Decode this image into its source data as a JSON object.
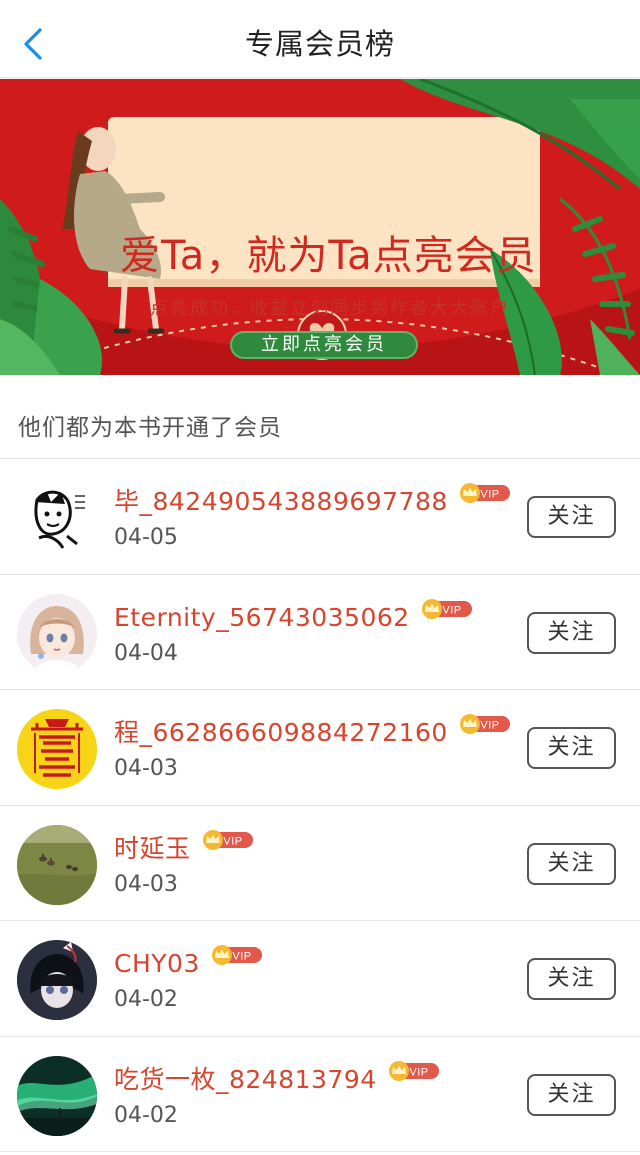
{
  "header": {
    "title": "专属会员榜",
    "back_icon": "chevron-left-icon"
  },
  "banner": {
    "headline": "爱Ta，就为Ta点亮会员",
    "subtitle": "点亮成功，收益立刻同步到作者大大账户",
    "button_label": "立即点亮会员",
    "colors": {
      "background": "#cf1b1c",
      "card": "#fbe3c3",
      "button": "#2f8a3e",
      "headline": "#d1281f"
    }
  },
  "section": {
    "title": "他们都为本书开通了会员"
  },
  "members": [
    {
      "name": "毕_842490543889697788",
      "badge": "VIP",
      "date": "04-05",
      "follow_label": "关注",
      "avatar": "sketch-avatar"
    },
    {
      "name": "Eternity_56743035062",
      "badge": "VIP",
      "date": "04-04",
      "follow_label": "关注",
      "avatar": "anime-girl-avatar"
    },
    {
      "name": "程_662866609884272160",
      "badge": "VIP",
      "date": "04-03",
      "follow_label": "关注",
      "avatar": "yellow-talisman-avatar"
    },
    {
      "name": "时延玉",
      "badge": "VIP",
      "date": "04-03",
      "follow_label": "关注",
      "avatar": "ducks-on-grass-avatar"
    },
    {
      "name": "CHY03",
      "badge": "VIP",
      "date": "04-02",
      "follow_label": "关注",
      "avatar": "anime-character-avatar"
    },
    {
      "name": "吃货一枚_824813794",
      "badge": "VIP",
      "date": "04-02",
      "follow_label": "关注",
      "avatar": "aurora-avatar"
    }
  ]
}
